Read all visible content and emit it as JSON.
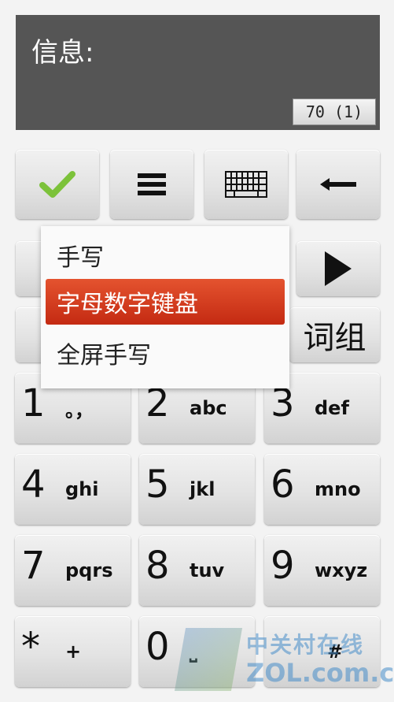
{
  "message": {
    "label": "信息:",
    "counter": "70 (1)"
  },
  "toolbar": {
    "confirm_icon": "check-icon",
    "options_icon": "menu-icon",
    "keyboard_icon": "keyboard-icon",
    "backspace_icon": "backspace-arrow-icon"
  },
  "second_row": {
    "phrase_label": "词组",
    "arrow_icon": "play-right-icon"
  },
  "input_menu": {
    "items": [
      {
        "label": "手写"
      },
      {
        "label": "字母数字键盘",
        "selected": true
      },
      {
        "label": "全屏手写"
      }
    ]
  },
  "keypad": {
    "keys": [
      {
        "digit": "1",
        "letters": "。，"
      },
      {
        "digit": "2",
        "letters": "abc"
      },
      {
        "digit": "3",
        "letters": "def"
      },
      {
        "digit": "4",
        "letters": "ghi"
      },
      {
        "digit": "5",
        "letters": "jkl"
      },
      {
        "digit": "6",
        "letters": "mno"
      },
      {
        "digit": "7",
        "letters": "pqrs"
      },
      {
        "digit": "8",
        "letters": "tuv"
      },
      {
        "digit": "9",
        "letters": "wxyz"
      },
      {
        "digit": "*",
        "letters": "+"
      },
      {
        "digit": "0",
        "letters": "⎵"
      },
      {
        "digit": "",
        "letters": "#"
      }
    ]
  },
  "watermark": {
    "cn": "中关村在线",
    "en": "ZOL.com.cn"
  },
  "colors": {
    "accent": "#d63a1c",
    "check": "#7cc23a",
    "panel": "#555555"
  }
}
